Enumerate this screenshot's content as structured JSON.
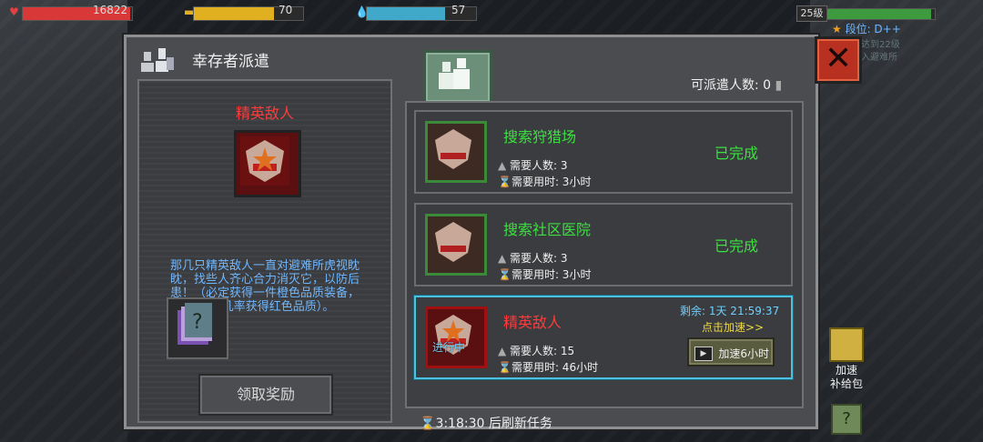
{
  "hud": {
    "health_value": "16822",
    "food_value": "70",
    "water_value": "57",
    "health_fill": 0.98,
    "food_fill": 0.73,
    "water_fill": 0.72
  },
  "player": {
    "level": "25级",
    "rank": "段位: D++",
    "faded_line1": "达到22级",
    "faded_line2": "入避难所"
  },
  "dialog": {
    "title": "幸存者派遣",
    "dispatch_count": "可派遣人数: 0",
    "refresh_text": "3:18:30 后刷新任务"
  },
  "detail": {
    "heading": "精英敌人",
    "description": "那几只精英敌人一直对避难所虎视眈眈，找些人齐心合力消灭它，以防后患！（必定获得一件橙色品质装备，30%几率获得红色品质）。",
    "claim_label": "领取奖励"
  },
  "tasks": [
    {
      "name": "搜索狩猎场",
      "people": "需要人数: 3",
      "time": "需要用时: 3小时",
      "status": "已完成"
    },
    {
      "name": "搜索社区医院",
      "people": "需要人数: 3",
      "time": "需要用时: 3小时",
      "status": "已完成"
    },
    {
      "name": "精英敌人",
      "people": "需要人数: 15",
      "time": "需要用时: 46小时",
      "ongoing": "进行中",
      "remaining": "剩余: 1天 21:59:37",
      "speed_link": "点击加速>>",
      "speed_button": "加速6小时"
    }
  ],
  "side": {
    "supply_label_1": "加速",
    "supply_label_2": "补给包",
    "help": "?"
  }
}
